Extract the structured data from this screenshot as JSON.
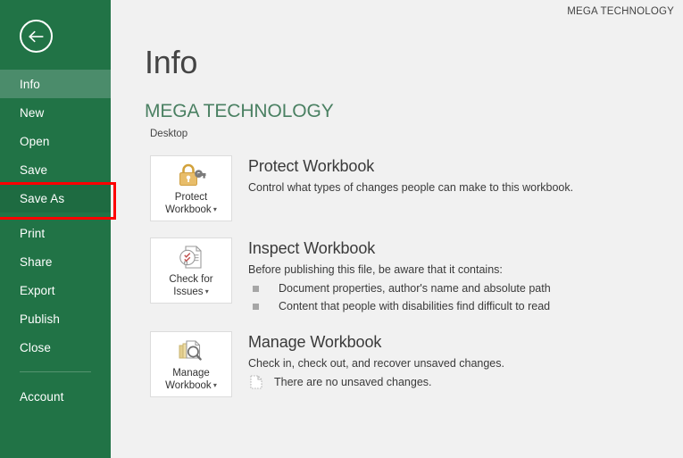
{
  "titlebar": {
    "account_name": "MEGA TECHNOLOGY"
  },
  "sidebar": {
    "back_icon": "back-arrow-icon",
    "items": [
      {
        "label": "Info",
        "state": "active"
      },
      {
        "label": "New",
        "state": "normal"
      },
      {
        "label": "Open",
        "state": "normal"
      },
      {
        "label": "Save",
        "state": "normal"
      },
      {
        "label": "Save As",
        "state": "highlighted"
      },
      {
        "label": "Print",
        "state": "normal"
      },
      {
        "label": "Share",
        "state": "normal"
      },
      {
        "label": "Export",
        "state": "normal"
      },
      {
        "label": "Publish",
        "state": "normal"
      },
      {
        "label": "Close",
        "state": "normal"
      },
      {
        "label": "Account",
        "state": "normal"
      }
    ],
    "highlight_color": "#ff0000",
    "background_color": "#217346",
    "active_color": "#4b8c6b"
  },
  "main": {
    "page_title": "Info",
    "document_title": "MEGA TECHNOLOGY",
    "document_path": "Desktop",
    "sections": [
      {
        "button_label_line1": "Protect",
        "button_label_line2": "Workbook",
        "button_icon": "padlock-key-icon",
        "heading": "Protect Workbook",
        "description": "Control what types of changes people can make to this workbook."
      },
      {
        "button_label_line1": "Check for",
        "button_label_line2": "Issues",
        "button_icon": "document-inspect-icon",
        "heading": "Inspect Workbook",
        "description": "Before publishing this file, be aware that it contains:",
        "bullets": [
          "Document properties, author's name and absolute path",
          "Content that people with disabilities find difficult to read"
        ]
      },
      {
        "button_label_line1": "Manage",
        "button_label_line2": "Workbook",
        "button_icon": "manage-documents-icon",
        "heading": "Manage Workbook",
        "description": "Check in, check out, and recover unsaved changes.",
        "status": "There are no unsaved changes.",
        "status_icon": "unsaved-document-icon"
      }
    ]
  }
}
